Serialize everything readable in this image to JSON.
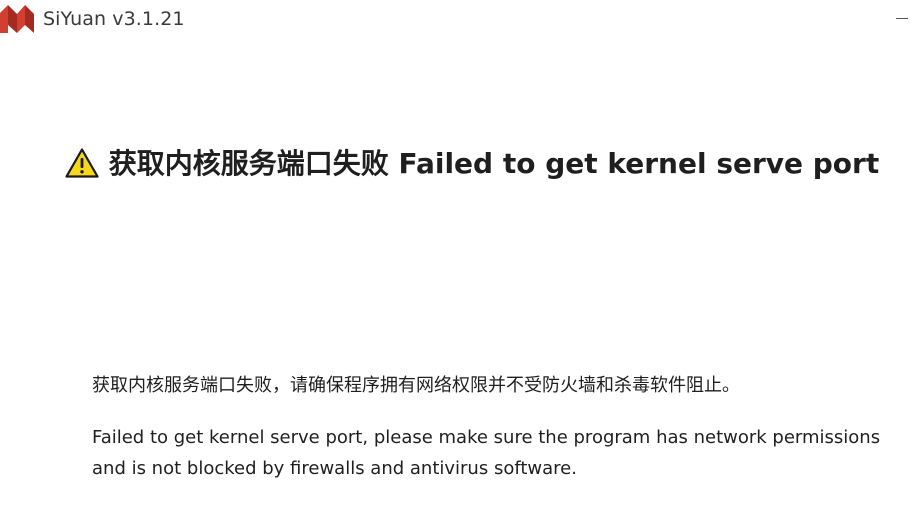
{
  "window": {
    "title": "SiYuan v3.1.21",
    "logo_icon": "siyuan-logo-icon",
    "minimize_icon": "minimize-icon"
  },
  "error": {
    "icon": "warning-icon",
    "heading": "获取内核服务端口失败 Failed to get kernel serve port",
    "message_cn": "获取内核服务端口失败，请确保程序拥有网络权限并不受防火墙和杀毒软件阻止。",
    "message_en": "Failed to get kernel serve port, please make sure the program has network permissions and is not blocked by firewalls and antivirus software."
  },
  "colors": {
    "logo_red": "#d23f31",
    "logo_dark": "#a42a22",
    "warning_yellow": "#f7d71a",
    "warning_outline": "#1a1a1a"
  }
}
